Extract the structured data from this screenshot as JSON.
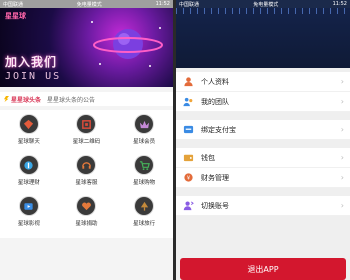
{
  "left": {
    "status": {
      "left": "中国联通",
      "mode": "免电量模式",
      "right": "11:52"
    },
    "banner": {
      "brand": "星星球",
      "slogan": "加入我们",
      "slogan_en": "JOIN US"
    },
    "notice": {
      "tag": "星星球头条",
      "text": "星星球头条的公告"
    },
    "grid": [
      {
        "label": "星球聊天",
        "icon": "diamond-icon",
        "color": "#e45b3b"
      },
      {
        "label": "星球二维码",
        "icon": "frame-icon",
        "color": "#d94b3b"
      },
      {
        "label": "星球会员",
        "icon": "crown-icon",
        "color": "#c48ad6"
      },
      {
        "label": "星球理财",
        "icon": "coin-icon",
        "color": "#3aa7e6"
      },
      {
        "label": "星球客服",
        "icon": "headset-icon",
        "color": "#e4793b"
      },
      {
        "label": "星球购物",
        "icon": "cart-icon",
        "color": "#45b35a"
      },
      {
        "label": "星球影视",
        "icon": "video-icon",
        "color": "#3a8ee6"
      },
      {
        "label": "星球捐助",
        "icon": "heart-icon",
        "color": "#e4793b"
      },
      {
        "label": "星球旅行",
        "icon": "tree-icon",
        "color": "#c48a3b"
      }
    ]
  },
  "right": {
    "status": {
      "left": "中国联通",
      "mode": "免电量模式",
      "right": "11:52"
    },
    "menu": [
      {
        "label": "个人资料",
        "icon": "user-icon",
        "color": "#e36b3a"
      },
      {
        "label": "我的团队",
        "icon": "team-icon",
        "color": "#3a8be4"
      },
      {
        "label": "绑定支付宝",
        "icon": "link-icon",
        "color": "#3a8be4"
      },
      {
        "label": "钱包",
        "icon": "wallet-icon",
        "color": "#e4a23a"
      },
      {
        "label": "财务管理",
        "icon": "finance-icon",
        "color": "#e36b3a"
      },
      {
        "label": "切换账号",
        "icon": "switch-user-icon",
        "color": "#8a5ce4"
      }
    ],
    "logout_label": "退出APP"
  }
}
